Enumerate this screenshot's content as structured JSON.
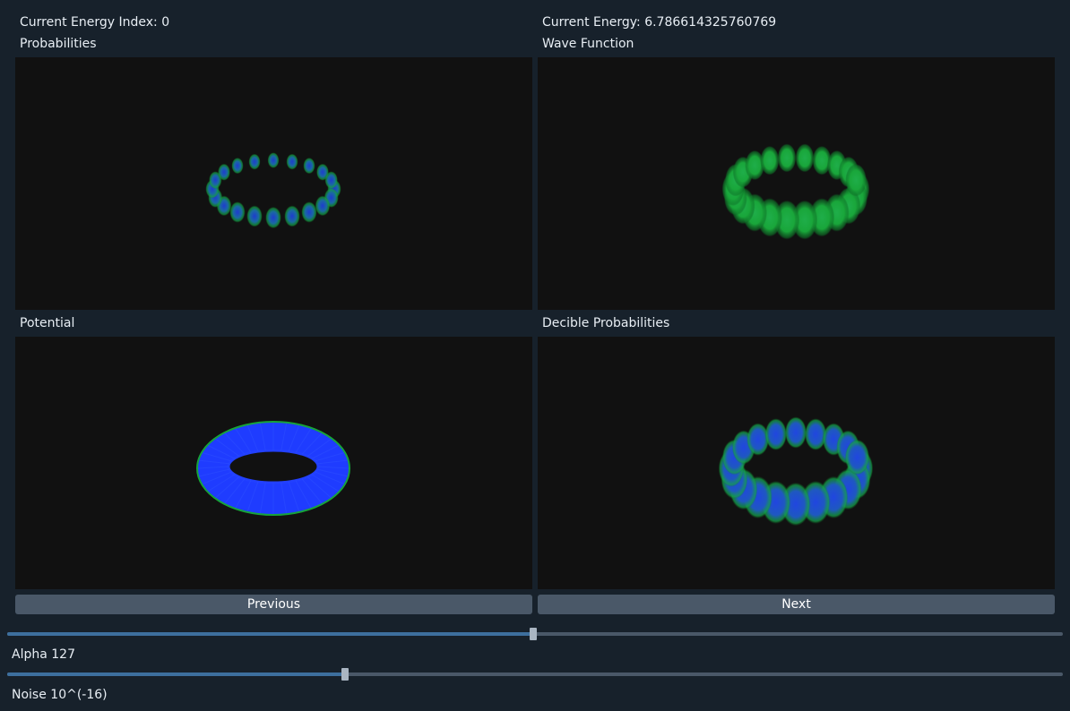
{
  "header": {
    "energy_index": "Current Energy Index: 0",
    "energy": "Current Energy: 6.786614325760769"
  },
  "panels": {
    "probabilities": "Probabilities",
    "wave_function": "Wave Function",
    "potential": "Potential",
    "decible_probabilities": "Decible Probabilities"
  },
  "buttons": {
    "previous": "Previous",
    "next": "Next"
  },
  "sliders": {
    "alpha": {
      "label": "Alpha 127",
      "value": 127,
      "min": 0,
      "max": 255
    },
    "noise": {
      "label": "Noise 10^(-16)",
      "value_fraction": 0.32
    }
  },
  "colors": {
    "background": "#17212b",
    "viewport": "#111111",
    "button": "#4a5868",
    "slider_fill": "#3d6f9e",
    "slider_track": "#4a5868",
    "torus_blue": "#1f3cff",
    "torus_green": "#18c040"
  }
}
